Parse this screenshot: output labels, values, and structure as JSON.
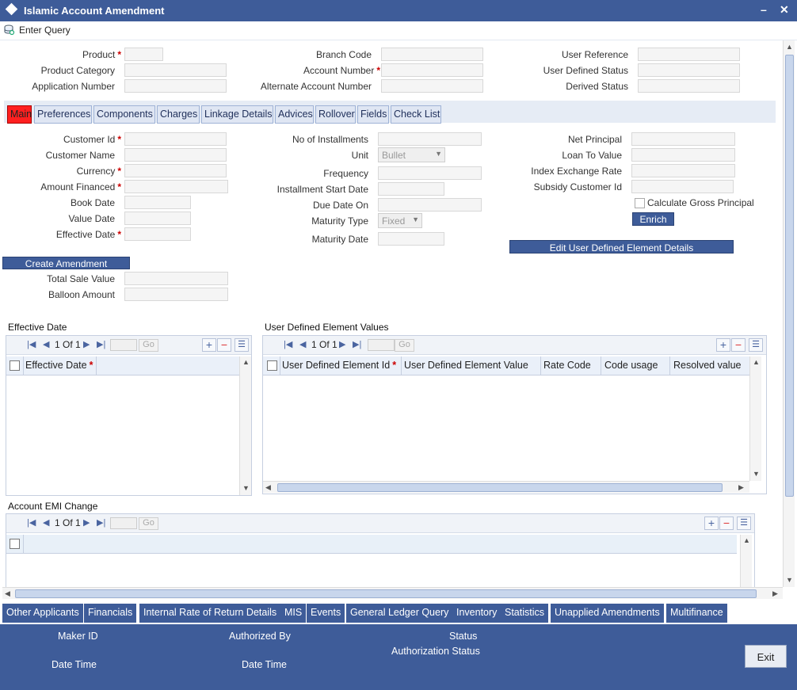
{
  "window": {
    "title": "Islamic Account Amendment",
    "minimize": "–",
    "close": "✕"
  },
  "toolbar": {
    "enter_query": "Enter Query"
  },
  "header_fields": {
    "product": "Product",
    "product_category": "Product Category",
    "application_number": "Application Number",
    "branch_code": "Branch Code",
    "account_number": "Account Number",
    "alternate_account_number": "Alternate Account Number",
    "user_reference": "User Reference",
    "user_defined_status": "User Defined Status",
    "derived_status": "Derived Status"
  },
  "tabs": [
    "Main",
    "Preferences",
    "Components",
    "Charges",
    "Linkage Details",
    "Advices",
    "Rollover",
    "Fields",
    "Check List"
  ],
  "main": {
    "customer_id": "Customer Id",
    "customer_name": "Customer Name",
    "currency": "Currency",
    "amount_financed": "Amount Financed",
    "book_date": "Book Date",
    "value_date": "Value Date",
    "effective_date": "Effective Date",
    "no_of_installments": "No of Installments",
    "unit": "Unit",
    "unit_value": "Bullet",
    "frequency": "Frequency",
    "installment_start_date": "Installment Start Date",
    "due_date_on": "Due Date On",
    "maturity_type": "Maturity Type",
    "maturity_type_value": "Fixed",
    "maturity_date": "Maturity Date",
    "net_principal": "Net Principal",
    "loan_to_value": "Loan To Value",
    "index_exchange_rate": "Index Exchange Rate",
    "subsidy_customer_id": "Subsidy Customer Id",
    "calculate_gross_principal": "Calculate Gross Principal",
    "enrich": "Enrich",
    "edit_udf_details": "Edit User Defined Element Details",
    "create_amendment": "Create Amendment",
    "total_sale_value": "Total Sale Value",
    "balloon_amount": "Balloon Amount"
  },
  "effective_date_grid": {
    "title": "Effective Date",
    "page": "1 Of 1",
    "go": "Go",
    "col": "Effective Date"
  },
  "udf_grid": {
    "title": "User Defined Element Values",
    "page": "1 Of 1",
    "go": "Go",
    "cols": [
      "User Defined Element Id",
      "User Defined Element Value",
      "Rate Code",
      "Code usage",
      "Resolved value"
    ]
  },
  "emi_grid": {
    "title": "Account EMI Change",
    "page": "1 Of 1",
    "go": "Go"
  },
  "bottom_tabs": [
    "Other Applicants",
    "Financials",
    "Internal Rate of Return Details",
    "MIS",
    "Events",
    "General Ledger Query",
    "Inventory",
    "Statistics",
    "Unapplied Amendments",
    "Multifinance"
  ],
  "footer": {
    "maker_id": "Maker ID",
    "date_time_1": "Date Time",
    "authorized_by": "Authorized By",
    "date_time_2": "Date Time",
    "status": "Status",
    "authorization_status": "Authorization Status",
    "exit": "Exit"
  }
}
